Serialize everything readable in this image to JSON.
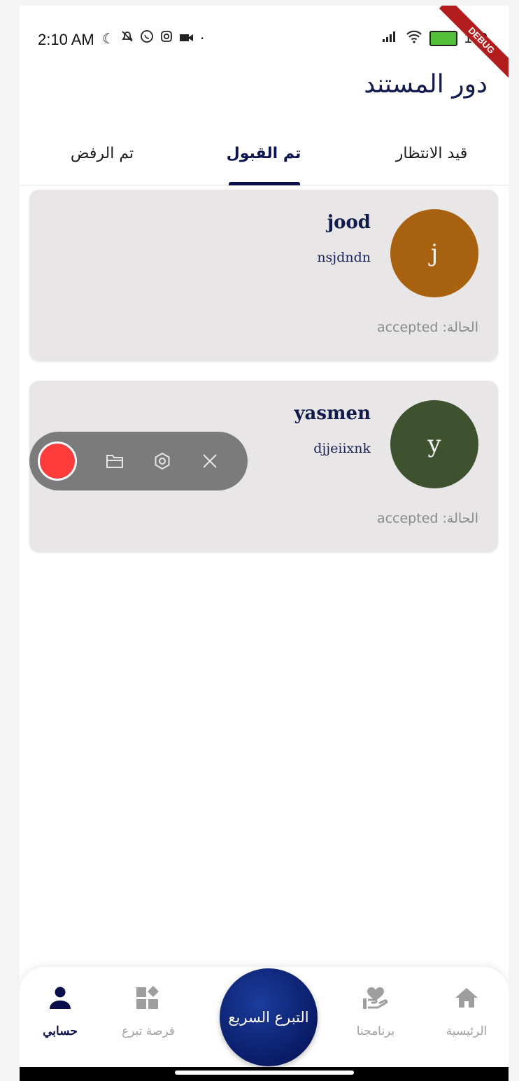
{
  "status_bar": {
    "time": "2:10 AM",
    "battery": "100",
    "debug_label": "DEBUG"
  },
  "header": {
    "title": "دور المستند"
  },
  "tabs": [
    {
      "label": "قيد الانتظار",
      "active": false
    },
    {
      "label": "تم القبول",
      "active": true
    },
    {
      "label": "تم الرفض",
      "active": false
    }
  ],
  "cards": [
    {
      "name": "jood",
      "subtitle": "nsjdndn",
      "avatar_letter": "j",
      "avatar_color": "#a8620f",
      "status": "الحالة: accepted"
    },
    {
      "name": "yasmen",
      "subtitle": "djjeiixnk",
      "avatar_letter": "y",
      "avatar_color": "#3f5230",
      "status": "الحالة: accepted"
    }
  ],
  "recorder": {
    "icons": [
      "record-icon",
      "folder-icon",
      "settings-icon",
      "close-icon"
    ]
  },
  "bottom_nav": {
    "items": [
      {
        "label": "الرئيسية",
        "icon": "home-icon",
        "active": false
      },
      {
        "label": "برنامجنا",
        "icon": "heart-hand-icon",
        "active": false
      },
      {
        "label": "فرصة تبرع",
        "icon": "grid-icon",
        "active": false
      },
      {
        "label": "حسابي",
        "icon": "person-icon",
        "active": true
      }
    ],
    "fab_label": "التبرع السريع"
  },
  "colors": {
    "primary": "#0a0f4c",
    "card_bg": "#e8e6e6",
    "record_red": "#ff3b3b"
  }
}
